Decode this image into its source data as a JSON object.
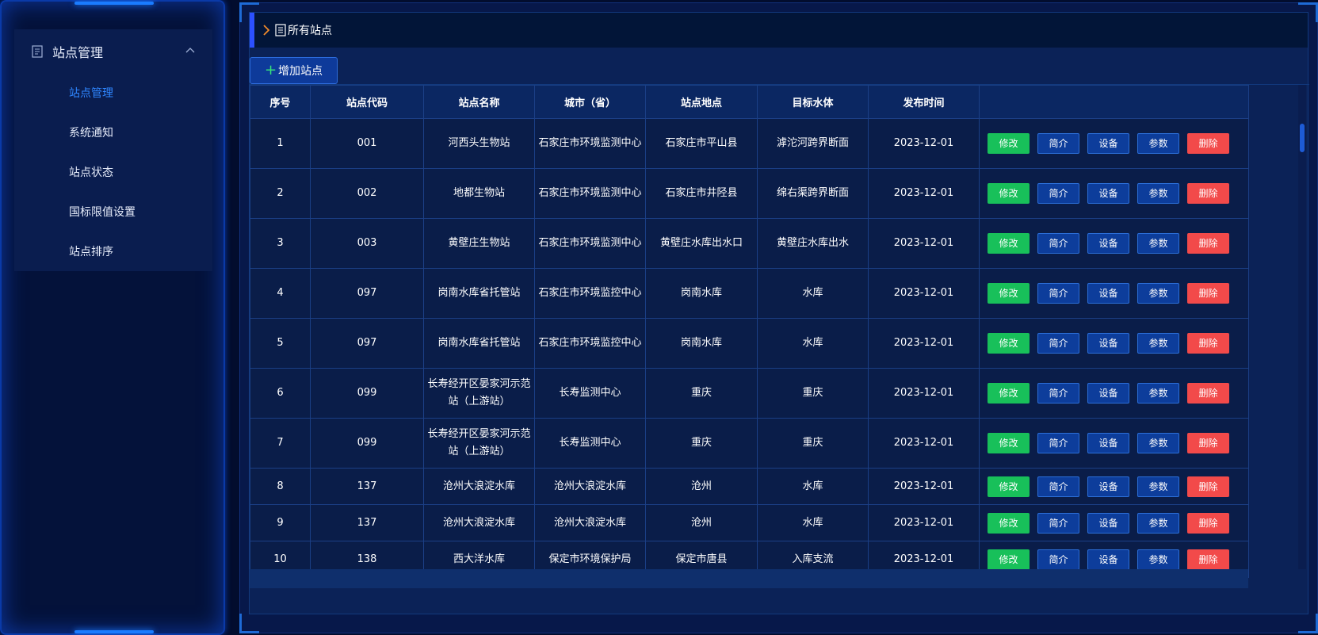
{
  "sidebar": {
    "group_label": "站点管理",
    "items": [
      {
        "label": "站点管理",
        "active": true
      },
      {
        "label": "系统通知",
        "active": false
      },
      {
        "label": "站点状态",
        "active": false
      },
      {
        "label": "国标限值设置",
        "active": false
      },
      {
        "label": "站点排序",
        "active": false
      }
    ]
  },
  "main": {
    "title": "所有站点",
    "add_button": "增加站点",
    "columns": [
      "序号",
      "站点代码",
      "站点名称",
      "城市（省）",
      "站点地点",
      "目标水体",
      "发布时间",
      ""
    ],
    "row_actions": [
      "修改",
      "简介",
      "设备",
      "参数",
      "删除"
    ],
    "rows": [
      [
        "1",
        "001",
        "河西头生物站",
        "石家庄市环境监测中心",
        "石家庄市平山县",
        "滹沱河跨界断面",
        "2023-12-01"
      ],
      [
        "2",
        "002",
        "地都生物站",
        "石家庄市环境监测中心",
        "石家庄市井陉县",
        "绵右渠跨界断面",
        "2023-12-01"
      ],
      [
        "3",
        "003",
        "黄壁庄生物站",
        "石家庄市环境监测中心",
        "黄壁庄水库出水口",
        "黄壁庄水库出水",
        "2023-12-01"
      ],
      [
        "4",
        "097",
        "岗南水库省托管站",
        "石家庄市环境监控中心",
        "岗南水库",
        "水库",
        "2023-12-01"
      ],
      [
        "5",
        "097",
        "岗南水库省托管站",
        "石家庄市环境监控中心",
        "岗南水库",
        "水库",
        "2023-12-01"
      ],
      [
        "6",
        "099",
        "长寿经开区晏家河示范站（上游站）",
        "长寿监测中心",
        "重庆",
        "重庆",
        "2023-12-01"
      ],
      [
        "7",
        "099",
        "长寿经开区晏家河示范站（上游站）",
        "长寿监测中心",
        "重庆",
        "重庆",
        "2023-12-01"
      ],
      [
        "8",
        "137",
        "沧州大浪淀水库",
        "沧州大浪淀水库",
        "沧州",
        "水库",
        "2023-12-01"
      ],
      [
        "9",
        "137",
        "沧州大浪淀水库",
        "沧州大浪淀水库",
        "沧州",
        "水库",
        "2023-12-01"
      ],
      [
        "10",
        "138",
        "西大洋水库",
        "保定市环境保护局",
        "保定市唐县",
        "入库支流",
        "2023-12-01"
      ]
    ]
  },
  "colors": {
    "accent": "#2f86ff",
    "edit": "#18c05a",
    "delete": "#f24a4a",
    "panel": "#0a1d49"
  },
  "icons": {
    "group": "document-icon",
    "collapse": "chevron-up-icon",
    "title_arrow": "chevron-right-icon",
    "title_list": "list-icon",
    "add": "plus-icon"
  }
}
